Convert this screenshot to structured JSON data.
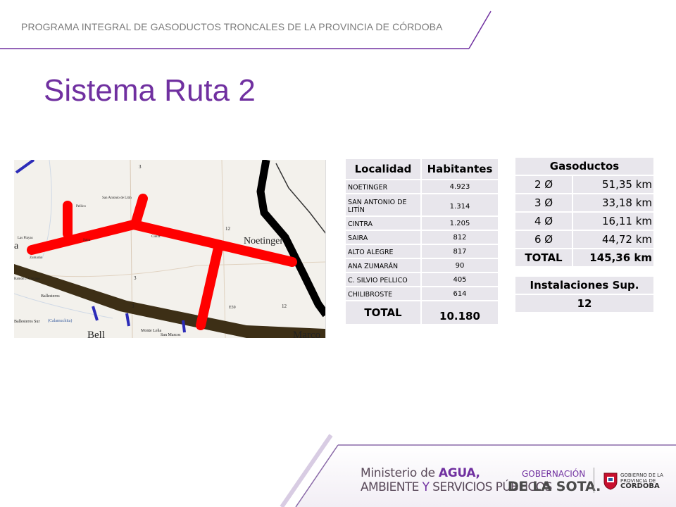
{
  "header": {
    "program": "PROGRAMA INTEGRAL DE GASODUCTOS TRONCALES DE LA PROVINCIA DE CÓRDOBA"
  },
  "title": "Sistema Ruta 2",
  "map": {
    "labels": [
      "Noetinger",
      "Marco",
      "Bell",
      "San Marcos",
      "Monte Leña",
      "Ballesteros",
      "Ballesteros Sur",
      "(Calamuchita)",
      "Zumarán",
      "San Antonio de Litín",
      "Pellico",
      "Saira",
      "Cintra",
      "Las Playas",
      "Ramón J. Cárcano",
      "3",
      "3",
      "3",
      "12",
      "12",
      "E59",
      "a"
    ]
  },
  "habitantes": {
    "headers": [
      "Localidad",
      "Habitantes"
    ],
    "rows": [
      {
        "loc": "NOETINGER",
        "hab": "4.923"
      },
      {
        "loc": "SAN ANTONIO DE LITÍN",
        "hab": "1.314"
      },
      {
        "loc": "CINTRA",
        "hab": "1.205"
      },
      {
        "loc": "SAIRA",
        "hab": "812"
      },
      {
        "loc": "ALTO ALEGRE",
        "hab": "817"
      },
      {
        "loc": "ANA ZUMARÁN",
        "hab": "90"
      },
      {
        "loc": "C. SILVIO PELLICO",
        "hab": "405"
      },
      {
        "loc": "CHILIBROSTE",
        "hab": "614"
      }
    ],
    "total_label": "TOTAL",
    "total_value": "10.180"
  },
  "gasoductos": {
    "header": "Gasoductos",
    "rows": [
      {
        "d": "2 Ø",
        "km": "51,35 km"
      },
      {
        "d": "3 Ø",
        "km": "33,18 km"
      },
      {
        "d": "4 Ø",
        "km": "16,11 km"
      },
      {
        "d": "6 Ø",
        "km": "44,72 km"
      }
    ],
    "total_label": "TOTAL",
    "total_value": "145,36 km"
  },
  "instalaciones": {
    "header": "Instalaciones Sup.",
    "value": "12"
  },
  "footer": {
    "ministerio_1a": "Ministerio de ",
    "ministerio_1b": "AGUA,",
    "ministerio_2a": "AMBIENTE ",
    "ministerio_2b": "Y ",
    "ministerio_2c": "SERVICIOS PÚBLICOS",
    "gobernacion": "GOBERNACIÓN",
    "de_la_sota": "DE LA SOTA.",
    "gobierno_1": "GOBIERNO DE LA",
    "gobierno_2": "PROVINCIA DE",
    "gobierno_3": "CÓRDOBA"
  },
  "colors": {
    "accent": "#7030a0",
    "pipe": "#ff0000",
    "table_bg": "#e8e6ec"
  }
}
